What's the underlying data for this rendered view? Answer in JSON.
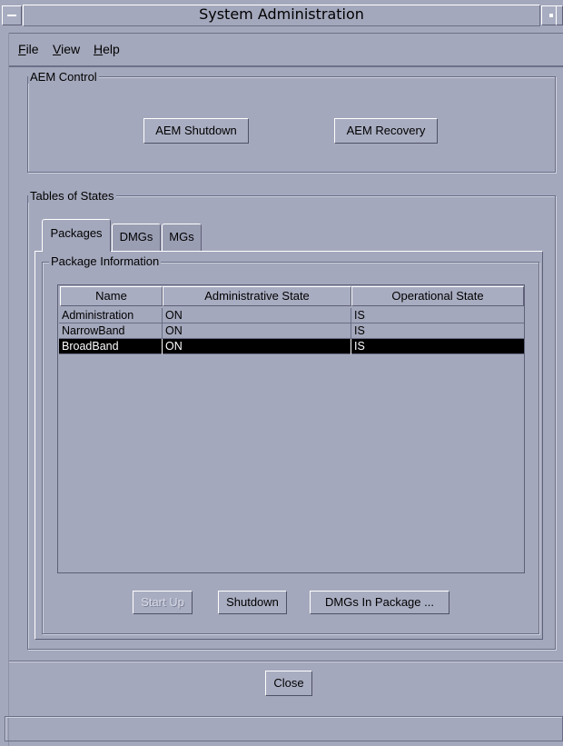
{
  "window": {
    "title": "System Administration"
  },
  "menubar": {
    "items": [
      {
        "label": "File",
        "mnemonic": "F",
        "rest": "ile"
      },
      {
        "label": "View",
        "mnemonic": "V",
        "rest": "iew"
      },
      {
        "label": "Help",
        "mnemonic": "H",
        "rest": "elp"
      }
    ]
  },
  "aem_control": {
    "label": "AEM Control",
    "shutdown_label": "AEM Shutdown",
    "recovery_label": "AEM Recovery"
  },
  "tables_of_states": {
    "label": "Tables of States",
    "tabs": [
      {
        "label": "Packages",
        "active": true
      },
      {
        "label": "DMGs",
        "active": false
      },
      {
        "label": "MGs",
        "active": false
      }
    ],
    "package_info": {
      "label": "Package Information",
      "columns": [
        "Name",
        "Administrative State",
        "Operational State"
      ],
      "rows": [
        {
          "name": "Administration",
          "admin_state": "ON",
          "op_state": "IS",
          "selected": false
        },
        {
          "name": "NarrowBand",
          "admin_state": "ON",
          "op_state": "IS",
          "selected": false
        },
        {
          "name": "BroadBand",
          "admin_state": "ON",
          "op_state": "IS",
          "selected": true
        }
      ],
      "buttons": {
        "start_up": "Start Up",
        "shutdown": "Shutdown",
        "dmgs_in_package": "DMGs In Package ..."
      }
    }
  },
  "footer": {
    "close_label": "Close",
    "status_text": ""
  }
}
